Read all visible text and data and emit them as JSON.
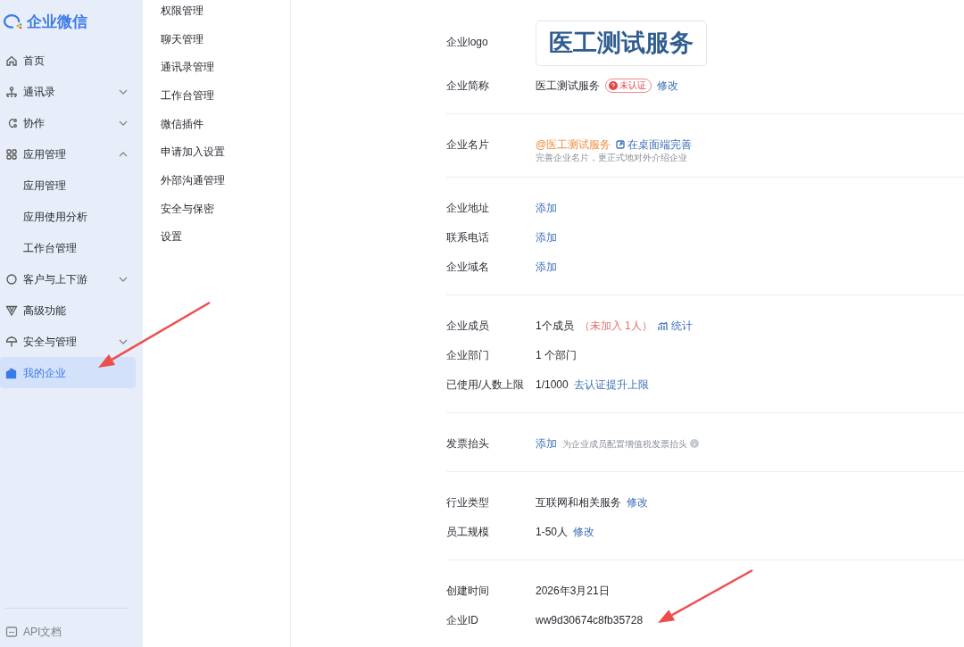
{
  "brand": {
    "name": "企业微信"
  },
  "sidebar": {
    "items": [
      {
        "label": "首页",
        "selected": false
      },
      {
        "label": "通讯录",
        "expanded": false,
        "selected": false
      },
      {
        "label": "协作",
        "expanded": false,
        "selected": false
      },
      {
        "label": "应用管理",
        "expanded": true,
        "selected": false,
        "children": [
          {
            "label": "应用管理",
            "selected": false
          },
          {
            "label": "应用使用分析",
            "selected": false
          },
          {
            "label": "工作台管理",
            "selected": false
          }
        ]
      },
      {
        "label": "客户与上下游",
        "expanded": false,
        "selected": false
      },
      {
        "label": "高级功能",
        "selected": false
      },
      {
        "label": "安全与管理",
        "expanded": false,
        "selected": false
      },
      {
        "label": "我的企业",
        "selected": true
      }
    ],
    "footer": [
      {
        "label": "API文档"
      }
    ]
  },
  "submenu": {
    "items": [
      {
        "label": "权限管理",
        "selected": false
      },
      {
        "label": "聊天管理",
        "selected": false
      },
      {
        "label": "通讯录管理",
        "selected": false
      },
      {
        "label": "工作台管理",
        "selected": false
      },
      {
        "label": "微信插件",
        "selected": false
      },
      {
        "label": "申请加入设置",
        "selected": false
      },
      {
        "label": "外部沟通管理",
        "selected": false
      },
      {
        "label": "安全与保密",
        "selected": false
      },
      {
        "label": "设置",
        "selected": false
      }
    ]
  },
  "sections": [
    {
      "rows": [
        {
          "label": "企业logo",
          "kind": "logo",
          "parts": [
            {
              "kind": "logo",
              "text": "医工测试服务"
            }
          ]
        },
        {
          "label": "企业简称",
          "kind": "line",
          "parts": [
            {
              "kind": "text",
              "text": "医工测试服务"
            },
            {
              "kind": "badge",
              "text": "未认证"
            },
            {
              "kind": "link",
              "text": "修改"
            }
          ]
        }
      ]
    },
    {
      "rows": [
        {
          "label": "企业名片",
          "kind": "line",
          "parts": [
            {
              "kind": "accent",
              "text": "@医工测试服务"
            },
            {
              "kind": "desktop-link",
              "text": "在桌面端完善"
            }
          ],
          "note": "完善企业名片，更正式地对外介绍企业"
        }
      ]
    },
    {
      "rows": [
        {
          "label": "企业地址",
          "kind": "line",
          "parts": [
            {
              "kind": "link",
              "text": "添加"
            }
          ]
        },
        {
          "label": "联系电话",
          "kind": "line",
          "parts": [
            {
              "kind": "link",
              "text": "添加"
            }
          ]
        },
        {
          "label": "企业域名",
          "kind": "line",
          "parts": [
            {
              "kind": "link",
              "text": "添加"
            }
          ]
        }
      ]
    },
    {
      "rows": [
        {
          "label": "企业成员",
          "kind": "line",
          "parts": [
            {
              "kind": "text",
              "text": "1个成员"
            },
            {
              "kind": "warn",
              "text": "（未加入 1人）"
            },
            {
              "kind": "stats-link",
              "text": "统计"
            }
          ]
        },
        {
          "label": "企业部门",
          "kind": "line",
          "parts": [
            {
              "kind": "text",
              "text": "1 个部门"
            }
          ]
        },
        {
          "label": "已使用/人数上限",
          "kind": "line",
          "parts": [
            {
              "kind": "text",
              "text": "1/1000"
            },
            {
              "kind": "link",
              "text": "去认证提升上限"
            }
          ]
        }
      ]
    },
    {
      "rows": [
        {
          "label": "发票抬头",
          "kind": "line",
          "parts": [
            {
              "kind": "link",
              "text": "添加"
            },
            {
              "kind": "hint",
              "text": "为企业成员配置增值税发票抬头"
            }
          ]
        }
      ]
    },
    {
      "rows": [
        {
          "label": "行业类型",
          "kind": "line",
          "parts": [
            {
              "kind": "text",
              "text": "互联网和相关服务"
            },
            {
              "kind": "link",
              "text": "修改"
            }
          ]
        },
        {
          "label": "员工规模",
          "kind": "line",
          "parts": [
            {
              "kind": "text",
              "text": "1-50人"
            },
            {
              "kind": "link",
              "text": "修改"
            }
          ]
        }
      ]
    },
    {
      "rows": [
        {
          "label": "创建时间",
          "kind": "line",
          "parts": [
            {
              "kind": "text",
              "text": "2026年3月21日"
            }
          ]
        },
        {
          "label": "企业ID",
          "kind": "line",
          "parts": [
            {
              "kind": "text",
              "text": "ww9d30674c8fb35728"
            }
          ]
        }
      ]
    }
  ]
}
